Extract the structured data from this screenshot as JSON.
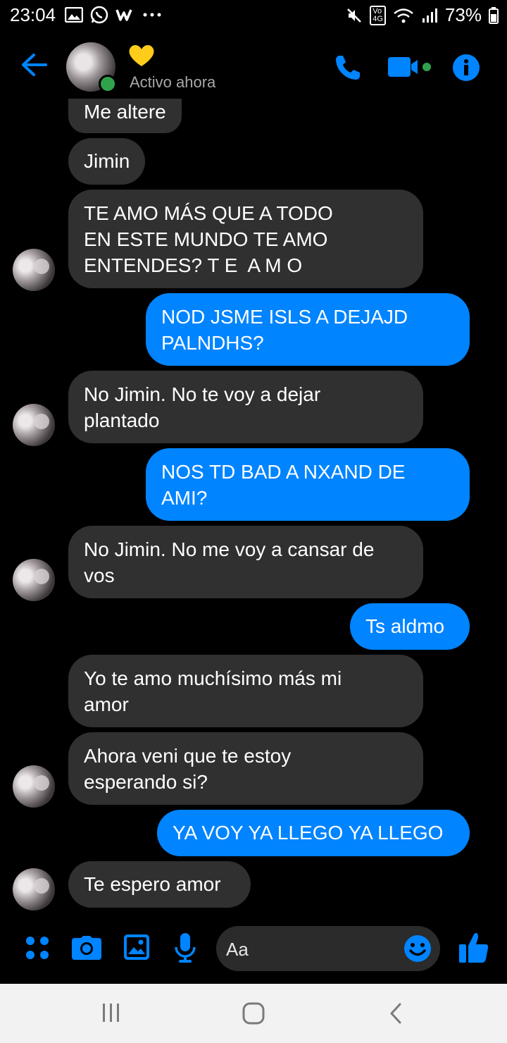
{
  "status_bar": {
    "time": "23:04",
    "battery_text": "73%",
    "network_label": "4G"
  },
  "header": {
    "status_text": "Activo ahora",
    "heart_emoji": "💛"
  },
  "messages": [
    {
      "side": "in",
      "text": "Me altere"
    },
    {
      "side": "in",
      "text": "Jimin"
    },
    {
      "side": "in",
      "lines": [
        "TE AMO MÁS QUE A TODO",
        "EN ESTE MUNDO TE AMO",
        "ENTENDES? T E  A M O"
      ]
    },
    {
      "side": "out",
      "lines": [
        "NOD JSME ISLS A DEJAJD",
        "PALNDHS?"
      ]
    },
    {
      "side": "in",
      "lines": [
        "No Jimin. No te voy a dejar",
        "plantado"
      ]
    },
    {
      "side": "out",
      "lines": [
        "NOS TD BAD A NXAND DE",
        "AMI?"
      ]
    },
    {
      "side": "in",
      "lines": [
        "No Jimin. No me voy a cansar de",
        "vos"
      ]
    },
    {
      "side": "out",
      "text": "Ts aldmo"
    },
    {
      "side": "in",
      "lines": [
        "Yo te amo muchísimo más mi",
        "amor"
      ]
    },
    {
      "side": "in",
      "lines": [
        "Ahora veni que te estoy",
        "esperando si?"
      ]
    },
    {
      "side": "out",
      "text": "YA VOY YA LLEGO YA LLEGO"
    },
    {
      "side": "in",
      "text": "Te espero amor"
    }
  ],
  "composer": {
    "placeholder": "Aa"
  },
  "colors": {
    "accent": "#0084ff",
    "incoming_bubble": "#303030",
    "active_green": "#31a24c"
  },
  "icons": [
    "back-arrow-icon",
    "phone-icon",
    "video-icon",
    "info-icon",
    "apps-icon",
    "camera-icon",
    "gallery-icon",
    "microphone-icon",
    "emoji-icon",
    "thumbs-up-icon",
    "nav-recents-icon",
    "nav-home-icon",
    "nav-back-icon"
  ]
}
